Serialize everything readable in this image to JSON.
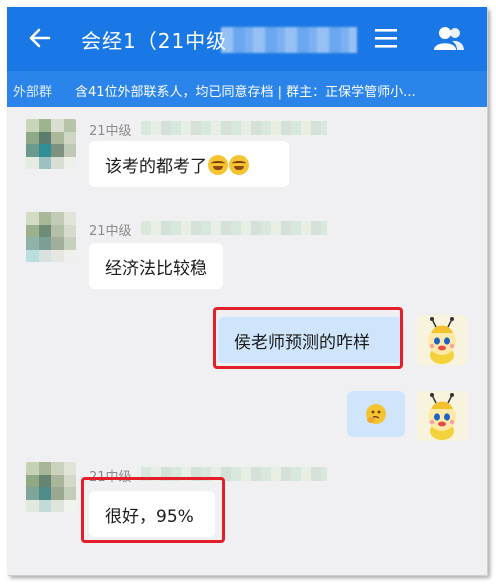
{
  "header": {
    "title": "会经1（21中级",
    "back_icon": "arrow-left-icon",
    "menu_icon": "menu-icon",
    "members_icon": "group-members-icon",
    "color": "#1977e6"
  },
  "notice": {
    "tag": "外部群",
    "text": "含41位外部联系人，均已同意存档 | 群主：正保学管师小..."
  },
  "messages": [
    {
      "sender": "21中级",
      "text": "该考的都考了",
      "emoji": "laughing-crying-emoji",
      "from_self": false
    },
    {
      "sender": "21中级",
      "text": "经济法比较稳",
      "from_self": false
    },
    {
      "text": "侯老师预测的咋样",
      "from_self": true,
      "highlighted": true
    },
    {
      "emoji": "thinking-face-emoji",
      "from_self": true
    },
    {
      "sender": "21中级",
      "text": "很好，95%",
      "from_self": false,
      "highlighted": true
    }
  ],
  "colors": {
    "highlight": "#e3202a",
    "self_bubble": "#cfe5fb",
    "background": "#f0f0f2"
  }
}
